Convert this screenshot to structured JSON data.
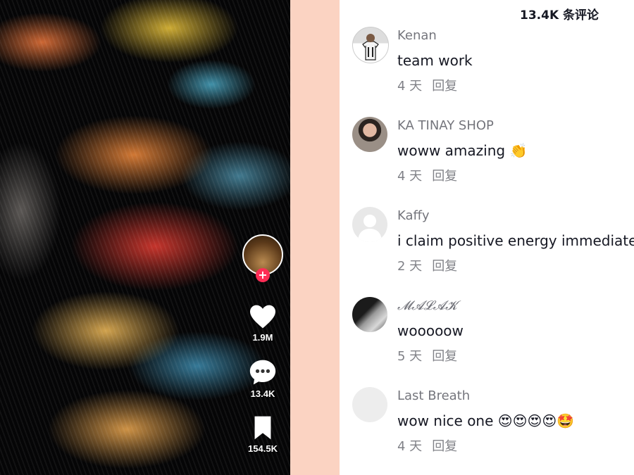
{
  "video": {
    "like_count": "1.9M",
    "comment_count": "13.4K",
    "bookmark_count": "154.5K",
    "follow_symbol": "+"
  },
  "panel": {
    "title": "13.4K 条评论",
    "comments": [
      {
        "username": "Kenan",
        "text": "team work",
        "time": "4 天",
        "reply": "回复",
        "avatar_color": "#d9d9d9"
      },
      {
        "username": "KA TINAY SHOP",
        "text": "woww amazing 👏",
        "time": "4 天",
        "reply": "回复",
        "avatar_color": "#3b3a44"
      },
      {
        "username": "Kaffy",
        "text": "i claim positive energy immediately",
        "time": "2 天",
        "reply": "回复",
        "avatar_color": "#e5e5e5"
      },
      {
        "username": "𝓜𝓐𝓛𝓐𝓚",
        "text": "wooooow",
        "time": "5 天",
        "reply": "回复",
        "avatar_color": "#6e6e6e"
      },
      {
        "username": "Last Breath",
        "text": "wow nice one 😍😍😍😍🤩",
        "time": "4 天",
        "reply": "回复",
        "avatar_color": "#ececec"
      }
    ]
  },
  "colors": {
    "accent_pink": "#fe2c55",
    "peach_strip": "#fbd3c2",
    "text_primary": "#161823"
  },
  "icons": [
    "heart-icon",
    "comment-bubble-icon",
    "bookmark-icon"
  ]
}
